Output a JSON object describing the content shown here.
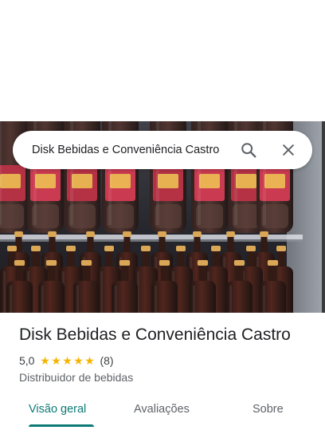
{
  "search": {
    "query": "Disk Bebidas e Conveniência Castro"
  },
  "place": {
    "name": "Disk Bebidas e Conveniência Castro",
    "rating": "5,0",
    "stars": 5,
    "review_count": "(8)",
    "category": "Distribuidor de bebidas"
  },
  "tabs": [
    {
      "label": "Visão geral",
      "active": true
    },
    {
      "label": "Avaliações",
      "active": false
    },
    {
      "label": "Sobre",
      "active": false
    }
  ],
  "icons": {
    "search": "search-icon",
    "close": "close-icon",
    "star": "star-icon"
  },
  "colors": {
    "accent": "#0b7a75",
    "star": "#f6b400"
  }
}
